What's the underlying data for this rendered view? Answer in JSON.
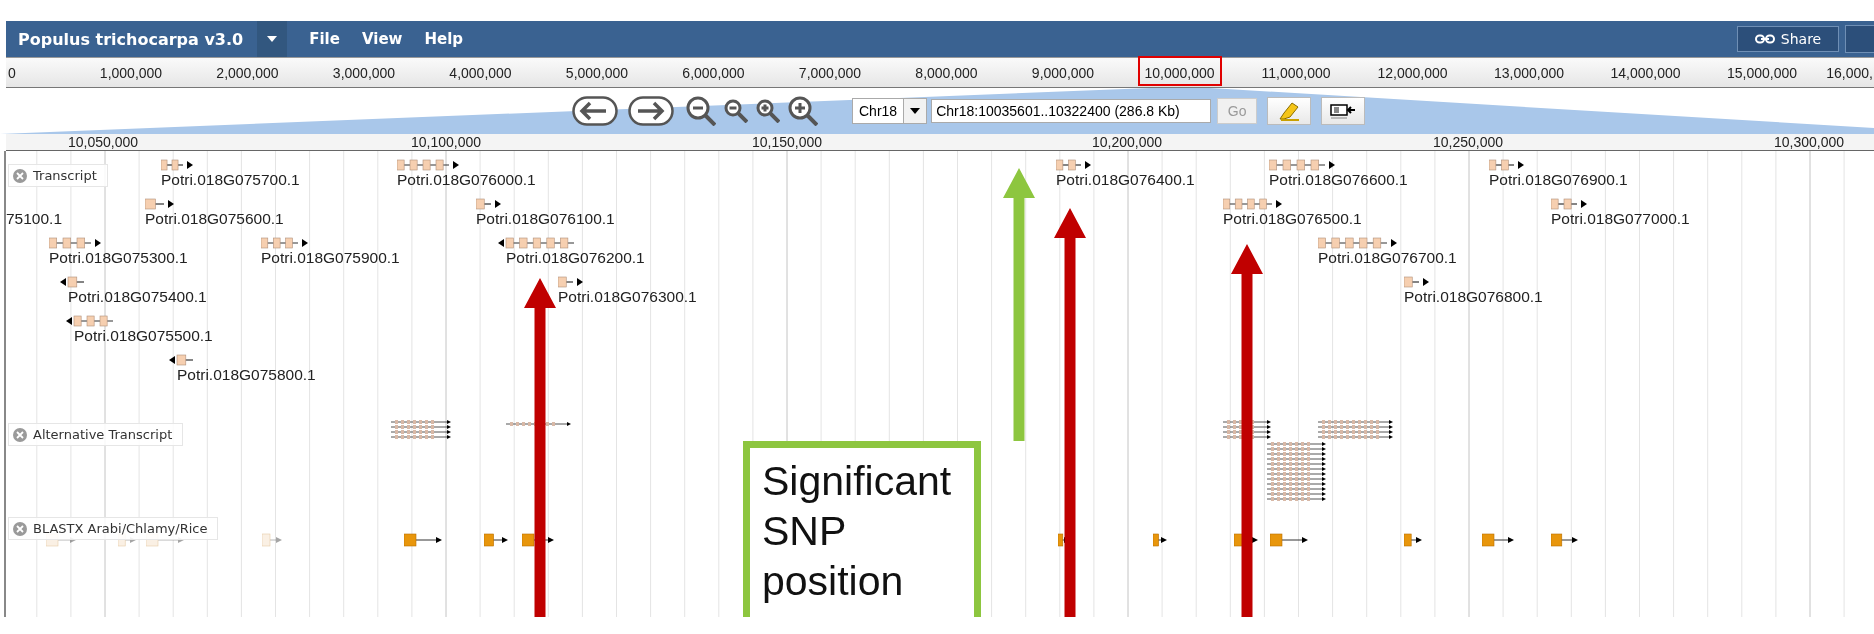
{
  "header": {
    "title": "Populus trichocarpa v3.0",
    "menus": [
      "File",
      "View",
      "Help"
    ],
    "share": "Share"
  },
  "overview_ruler": {
    "ticks": [
      {
        "label": "0",
        "marked": false
      },
      {
        "label": "1,000,000",
        "marked": false
      },
      {
        "label": "2,000,000",
        "marked": false
      },
      {
        "label": "3,000,000",
        "marked": false
      },
      {
        "label": "4,000,000",
        "marked": false
      },
      {
        "label": "5,000,000",
        "marked": false
      },
      {
        "label": "6,000,000",
        "marked": false
      },
      {
        "label": "7,000,000",
        "marked": false
      },
      {
        "label": "8,000,000",
        "marked": false
      },
      {
        "label": "9,000,000",
        "marked": false
      },
      {
        "label": "10,000,000",
        "marked": true
      },
      {
        "label": "11,000,000",
        "marked": false
      },
      {
        "label": "12,000,000",
        "marked": false
      },
      {
        "label": "13,000,000",
        "marked": false
      },
      {
        "label": "14,000,000",
        "marked": false
      },
      {
        "label": "15,000,000",
        "marked": false
      },
      {
        "label": "16,000,",
        "marked": false
      }
    ]
  },
  "navigation": {
    "chromosome": "Chr18",
    "location": "Chr18:10035601..10322400 (286.8 Kb)",
    "go": "Go"
  },
  "detail_ruler": [
    "10,050,000",
    "10,100,000",
    "10,150,000",
    "10,200,000",
    "10,250,000",
    "10,300,000"
  ],
  "tracks": [
    {
      "label": "Transcript",
      "kind": "genes",
      "features": [
        {
          "name": "Potri.018G075700.1",
          "reverse": false
        },
        {
          "name": "Potri.018G076000.1",
          "reverse": false
        },
        {
          "name": "Potri.018G076400.1",
          "reverse": false
        },
        {
          "name": "Potri.018G076600.1",
          "reverse": false
        },
        {
          "name": "Potri.018G076900.1",
          "reverse": false
        },
        {
          "name": "75100.1"
        },
        {
          "name": "Potri.018G075600.1",
          "reverse": false
        },
        {
          "name": "Potri.018G076100.1",
          "reverse": false
        },
        {
          "name": "Potri.018G076500.1",
          "reverse": false
        },
        {
          "name": "Potri.018G077000.1",
          "reverse": false
        },
        {
          "name": "Potri.018G075300.1",
          "reverse": false
        },
        {
          "name": "Potri.018G075900.1",
          "reverse": false
        },
        {
          "name": "Potri.018G076200.1",
          "reverse": true
        },
        {
          "name": "Potri.018G076700.1",
          "reverse": false
        },
        {
          "name": "Potri.018G075400.1",
          "reverse": true
        },
        {
          "name": "Potri.018G076300.1",
          "reverse": false
        },
        {
          "name": "Potri.018G076800.1",
          "reverse": false
        },
        {
          "name": "Potri.018G075500.1",
          "reverse": true
        },
        {
          "name": "Potri.018G075800.1",
          "reverse": true
        }
      ]
    },
    {
      "label": "Alternative Transcript",
      "kind": "isoforms"
    },
    {
      "label": "BLASTX Arabi/Chlamy/Rice",
      "kind": "blast"
    }
  ],
  "annotations": {
    "callout": "Significant SNP position",
    "arrows": [
      {
        "color": "#8dc63f"
      },
      {
        "color": "#c00000"
      },
      {
        "color": "#c00000"
      },
      {
        "color": "#c00000"
      }
    ]
  }
}
